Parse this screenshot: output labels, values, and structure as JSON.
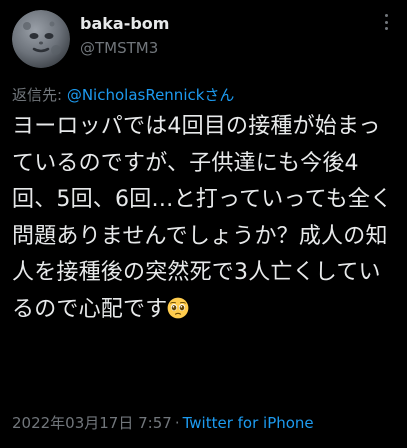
{
  "tweet": {
    "display_name": "baka-bom",
    "handle": "@TMSTM3",
    "reply_prefix": "返信先: ",
    "reply_to": "@NicholasRennickさん",
    "text": "ヨーロッパでは4回目の接種が始まっているのですが、子供達にも今後4回、5回、6回…と打っていっても全く問題ありませんでしょうか？成人の知人を接種後の突然死で3人亡くしているので心配です",
    "emoji": "pleading-face-emoji",
    "timestamp": "2022年03月17日 7:57",
    "separator": "·",
    "source": "Twitter for iPhone"
  },
  "colors": {
    "background": "#000000",
    "text": "#e7e9ea",
    "muted": "#71767b",
    "link": "#1d9bf0",
    "emoji": "#ffcc4d"
  },
  "icons": {
    "avatar": "full-moon-face",
    "more": "more-options-icon"
  }
}
